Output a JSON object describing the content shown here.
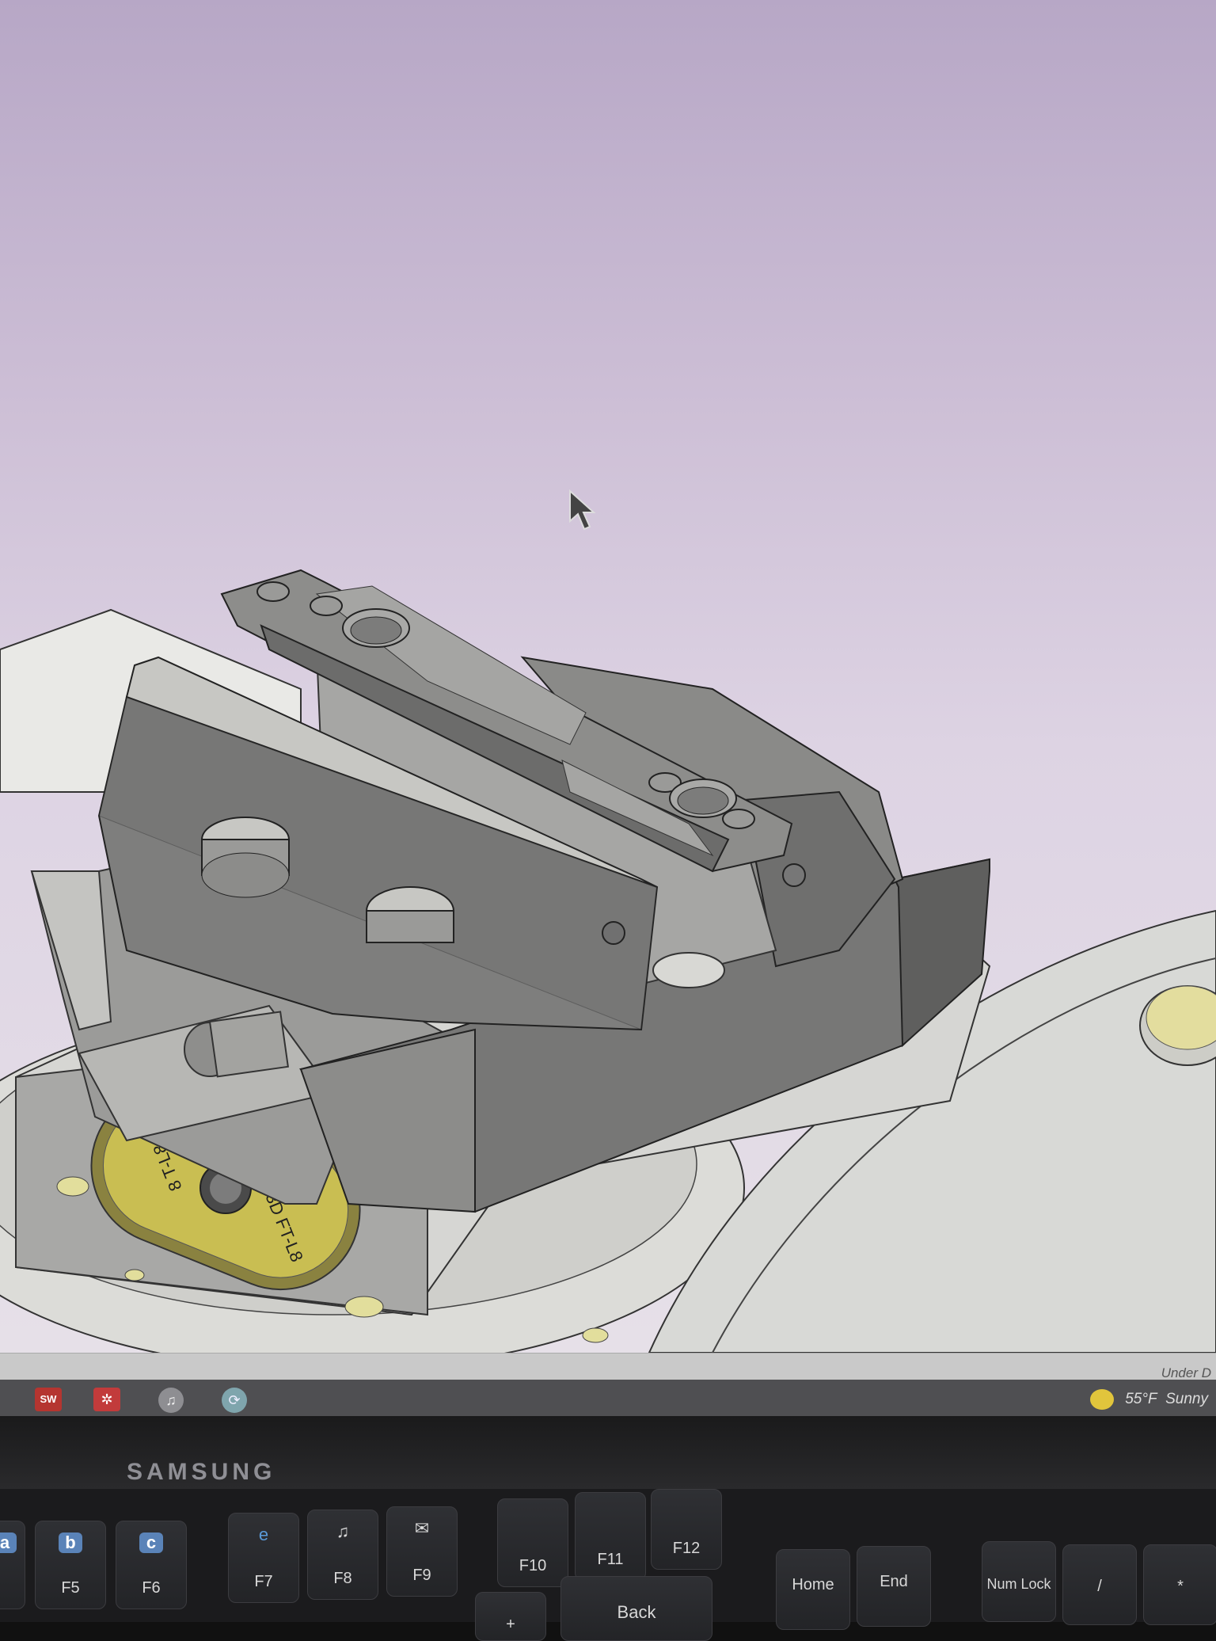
{
  "viewport": {
    "background": "#ddd3e3"
  },
  "status_bar": {
    "right_text": "Under D"
  },
  "taskbar": {
    "icons": [
      {
        "name": "solidworks-2022-icon",
        "label": "SW 2022"
      },
      {
        "name": "snipping-tool-icon",
        "label": ""
      },
      {
        "name": "music-icon",
        "label": ""
      },
      {
        "name": "sync-icon",
        "label": ""
      }
    ],
    "weather": {
      "temp": "55°F",
      "condition": "Sunny"
    }
  },
  "monitor": {
    "brand": "SAMSUNG"
  },
  "part": {
    "label_text": "3D FT-L8",
    "label_text_2": "8 T-L8"
  },
  "keyboard": {
    "keys": [
      {
        "id": "f5",
        "main": "F5",
        "top": "b"
      },
      {
        "id": "f6",
        "main": "F6",
        "top": "c"
      },
      {
        "id": "f7",
        "main": "F7",
        "top": "e"
      },
      {
        "id": "f8",
        "main": "F8",
        "top": "♫"
      },
      {
        "id": "f9",
        "main": "F9",
        "top": "✉"
      },
      {
        "id": "f10",
        "main": "F10",
        "top": ""
      },
      {
        "id": "f11",
        "main": "F11",
        "top": ""
      },
      {
        "id": "f12",
        "main": "F12",
        "top": ""
      },
      {
        "id": "plus",
        "main": "+",
        "top": ""
      },
      {
        "id": "back",
        "main": "Back",
        "top": ""
      },
      {
        "id": "home",
        "main": "Home",
        "top": ""
      },
      {
        "id": "end",
        "main": "End",
        "top": ""
      },
      {
        "id": "numlock",
        "main": "Num Lock",
        "top": ""
      },
      {
        "id": "slash",
        "main": "/",
        "top": ""
      },
      {
        "id": "star",
        "main": "*",
        "top": ""
      }
    ]
  }
}
